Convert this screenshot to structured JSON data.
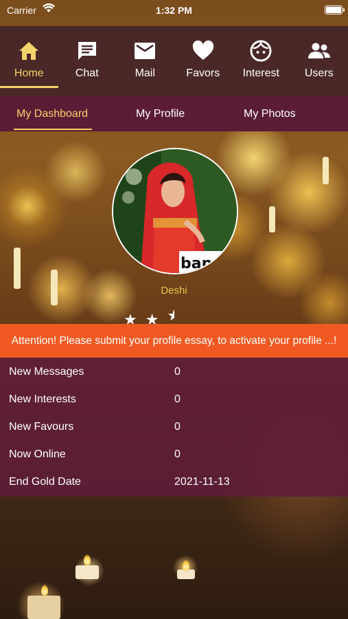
{
  "status_bar": {
    "carrier": "Carrier",
    "time": "1:32 PM"
  },
  "nav": {
    "items": [
      {
        "label": "Home",
        "icon": "home-icon",
        "active": true
      },
      {
        "label": "Chat",
        "icon": "chat-icon",
        "active": false
      },
      {
        "label": "Mail",
        "icon": "mail-icon",
        "active": false
      },
      {
        "label": "Favors",
        "icon": "heart-icon",
        "active": false
      },
      {
        "label": "Interest",
        "icon": "face-icon",
        "active": false
      },
      {
        "label": "Users",
        "icon": "users-icon",
        "active": false
      }
    ]
  },
  "tabs": {
    "items": [
      {
        "label": "My Dashboard",
        "active": true
      },
      {
        "label": "My Profile",
        "active": false
      },
      {
        "label": "My Photos",
        "active": false
      }
    ]
  },
  "profile": {
    "name": "Deshi",
    "photo_text": "bang",
    "rating": 2.5,
    "rating_max": 5
  },
  "alert": {
    "text": "Attention! Please submit your profile essay, to activate your profile ...!"
  },
  "stats": {
    "rows": [
      {
        "label": "New Messages",
        "value": "0"
      },
      {
        "label": "New Interests",
        "value": "0"
      },
      {
        "label": "New Favours",
        "value": "0"
      },
      {
        "label": "Now Online",
        "value": "0"
      },
      {
        "label": "End Gold Date",
        "value": "2021-11-13"
      }
    ]
  },
  "colors": {
    "accent": "#f3d36b",
    "nav_bg": "#46262a",
    "tab_bg": "#5b1c36",
    "alert_bg": "#f05a22",
    "username": "#e8c24a"
  }
}
